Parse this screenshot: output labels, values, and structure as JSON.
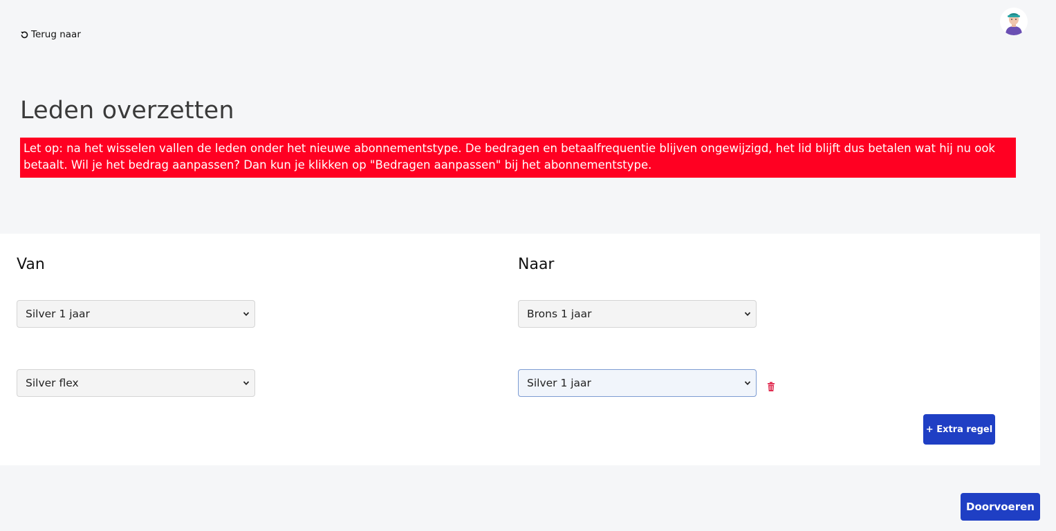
{
  "nav": {
    "back_label": "Terug naar"
  },
  "header": {
    "avatar_icon": "user-avatar-icon"
  },
  "page": {
    "title": "Leden overzetten",
    "warning": "Let op: na het wisselen vallen de leden onder het nieuwe abonnementstype. De bedragen en betaalfrequentie blijven ongewijzigd, het lid blijft dus betalen wat hij nu ook betaalt. Wil je het bedrag aanpassen? Dan kun je klikken op \"Bedragen aanpassen\" bij het abonnementstype."
  },
  "form": {
    "from_heading": "Van",
    "to_heading": "Naar",
    "rows": [
      {
        "from": "Silver 1 jaar",
        "to": "Brons 1 jaar"
      },
      {
        "from": "Silver flex",
        "to": "Silver 1 jaar"
      }
    ],
    "add_row_label": "+ Extra regel"
  },
  "actions": {
    "submit_label": "Doorvoeren"
  },
  "colors": {
    "warning_bg": "#ff0022",
    "primary": "#1f3fc4",
    "delete": "#e02a4f"
  }
}
